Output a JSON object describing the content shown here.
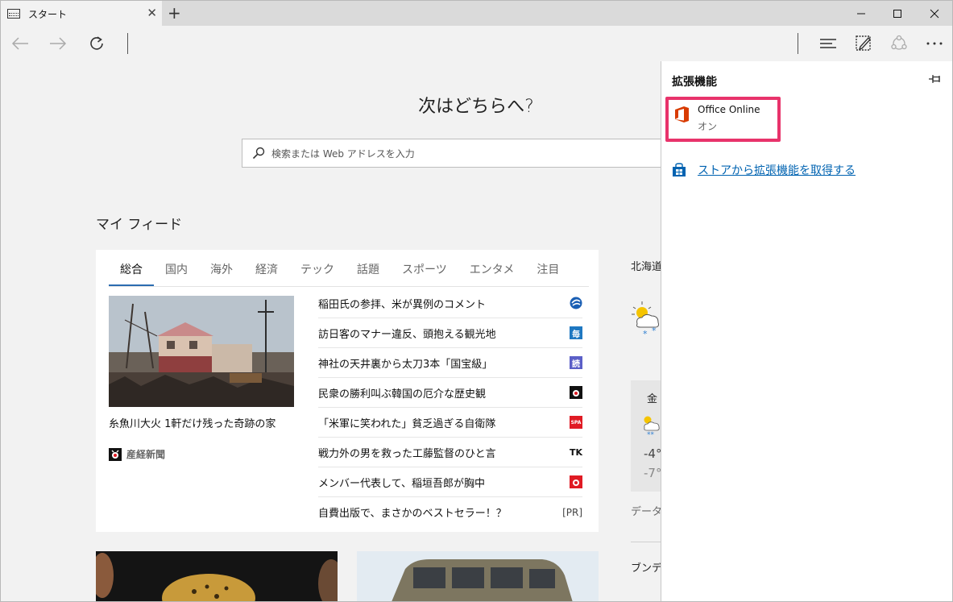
{
  "tab": {
    "title": "スタート"
  },
  "window": {
    "new_tab": "+",
    "minimize": "—",
    "maximize": "☐",
    "close": "✕"
  },
  "start": {
    "heading": "次はどちらへ?",
    "search_placeholder": "検索または Web アドレスを入力",
    "feed_title": "マイ フィード"
  },
  "categories": [
    "総合",
    "国内",
    "海外",
    "経済",
    "テック",
    "話題",
    "スポーツ",
    "エンタメ",
    "注目"
  ],
  "hero": {
    "caption": "糸魚川大火 1軒だけ残った奇跡の家",
    "source": "産経新聞"
  },
  "news": [
    {
      "title": "稲田氏の参拝、米が異例のコメント",
      "logo": "#1a5fb4",
      "logo_text": ""
    },
    {
      "title": "訪日客のマナー違反、頭抱える観光地",
      "logo": "#1f78c1",
      "logo_text": "毎"
    },
    {
      "title": "神社の天井裏から太刀3本「国宝級」",
      "logo": "#5b5fc7",
      "logo_text": "読"
    },
    {
      "title": "民衆の勝利叫ぶ韓国の厄介な歴史観",
      "logo": "#111111",
      "logo_text": ""
    },
    {
      "title": "「米軍に笑われた」貧乏過ぎる自衛隊",
      "logo": "#e01b24",
      "logo_text": "SPA"
    },
    {
      "title": "戦力外の男を救った工藤監督のひと言",
      "logo": "#ffffff",
      "logo_text": "TK"
    },
    {
      "title": "メンバー代表して、稲垣吾郎が胸中",
      "logo": "#e01b24",
      "logo_text": ""
    },
    {
      "title": "自費出版で、まさかのベストセラー！？",
      "logo": "",
      "logo_text": "[PR]"
    }
  ],
  "weather": {
    "region": "北海道",
    "day": "金",
    "high": "-4°",
    "low": "-7°",
    "source": "データ",
    "more": "ブンデ"
  },
  "extensions_panel": {
    "title": "拡張機能",
    "extension": {
      "name": "Office Online",
      "status": "オン"
    },
    "store_link": "ストアから拡張機能を取得する"
  },
  "colors": {
    "highlight": "#e8336b",
    "link": "#0063b1",
    "office": "#d83b01",
    "active_tab_underline": "#2b6cb0"
  }
}
